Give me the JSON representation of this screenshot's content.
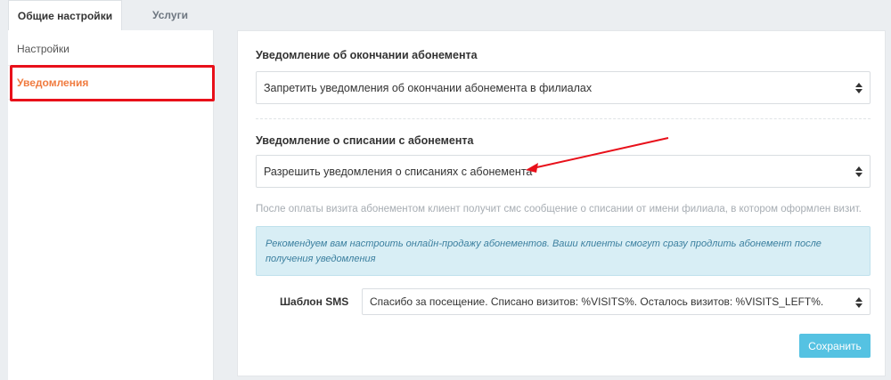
{
  "tabs": {
    "general": "Общие настройки",
    "services": "Услуги"
  },
  "sidebar": {
    "items": [
      {
        "label": "Настройки"
      },
      {
        "label": "Уведомления"
      }
    ]
  },
  "main": {
    "section1": {
      "label": "Уведомление об окончании абонемента",
      "value": "Запретить уведомления об окончании абонемента в филиалах"
    },
    "section2": {
      "label": "Уведомление о списании с абонемента",
      "value": "Разрешить уведомления о списаниях с абонемента",
      "hint": "После оплаты визита абонементом клиент получит смс сообщение о списании от имени филиала, в котором оформлен визит."
    },
    "info": "Рекомендуем вам настроить онлайн-продажу абонементов. Ваши клиенты смогут сразу продлить абонемент после получения уведомления",
    "sms": {
      "label": "Шаблон SMS",
      "value": "Спасибо за посещение. Списано визитов: %VISITS%. Осталось визитов: %VISITS_LEFT%."
    },
    "save_label": "Сохранить"
  },
  "colors": {
    "accent_orange": "#f07b3f",
    "highlight_red": "#e8101a",
    "button_blue": "#55c2e2",
    "info_bg": "#d8eef5"
  }
}
